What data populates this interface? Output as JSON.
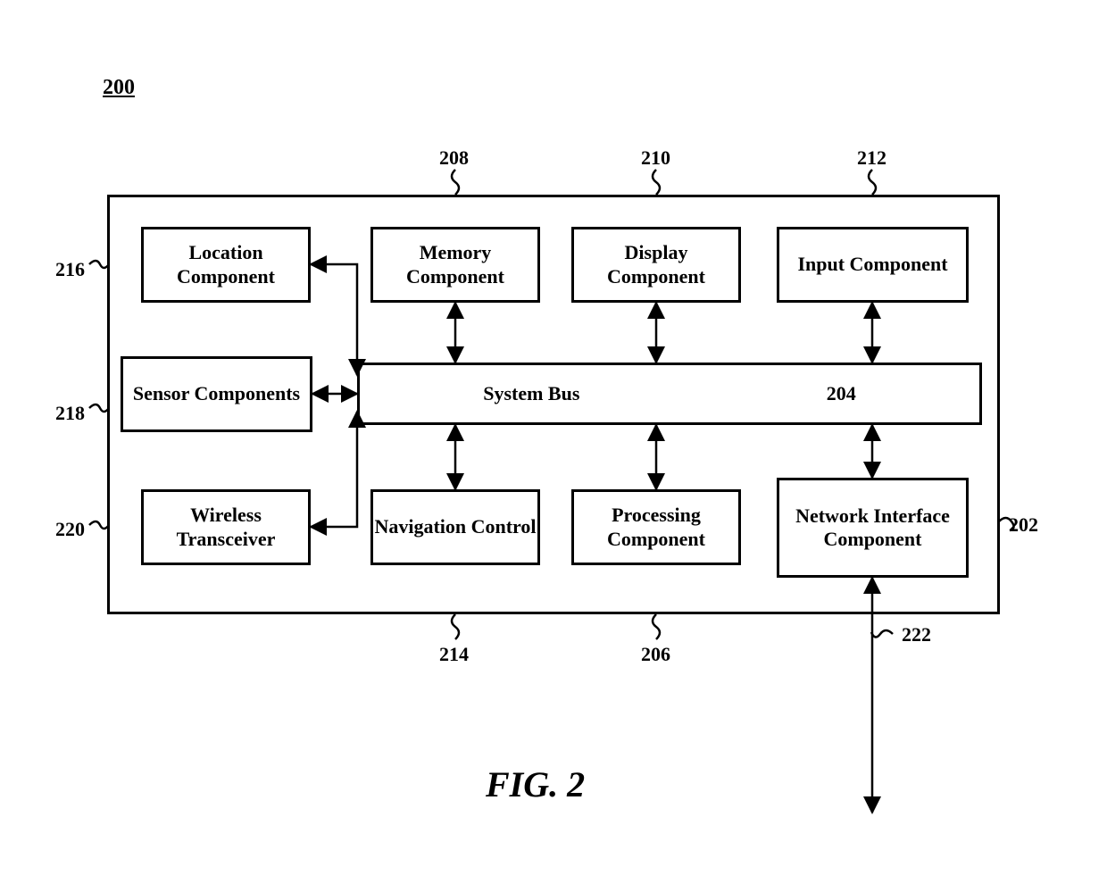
{
  "figure_ref": "200",
  "figure_title": "FIG. 2",
  "boxes": {
    "location": "Location Component",
    "sensor": "Sensor Components",
    "wireless": "Wireless Transceiver",
    "memory": "Memory Component",
    "display": "Display Component",
    "input": "Input Component",
    "navigation": "Navigation Control",
    "processing": "Processing Component",
    "network": "Network Interface Component",
    "system_bus": "System Bus",
    "system_bus_ref": "204"
  },
  "refs": {
    "r202": "202",
    "r206": "206",
    "r208": "208",
    "r210": "210",
    "r212": "212",
    "r214": "214",
    "r216": "216",
    "r218": "218",
    "r220": "220",
    "r222": "222"
  }
}
